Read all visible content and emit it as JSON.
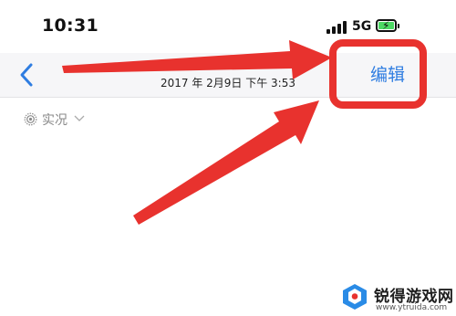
{
  "status_bar": {
    "time": "10:31",
    "network": "5G",
    "signal_icon": "cellular-signal-icon",
    "battery_icon": "battery-charging-icon",
    "battery_color": "#4cd964"
  },
  "nav": {
    "back_icon": "chevron-left-icon",
    "subtitle": "2017 年 2月9日  下午 3:53",
    "edit_label": "编辑",
    "accent_color": "#2f7de1"
  },
  "live_photo": {
    "label": "实况",
    "icon": "live-photo-icon",
    "chevron_icon": "chevron-down-icon"
  },
  "annotation": {
    "color": "#e8322e",
    "highlight_target": "编辑",
    "arrow_icon": "pointer-arrow-icon"
  },
  "watermark": {
    "title": "锐得游戏网",
    "url": "www.ytruida.com"
  }
}
